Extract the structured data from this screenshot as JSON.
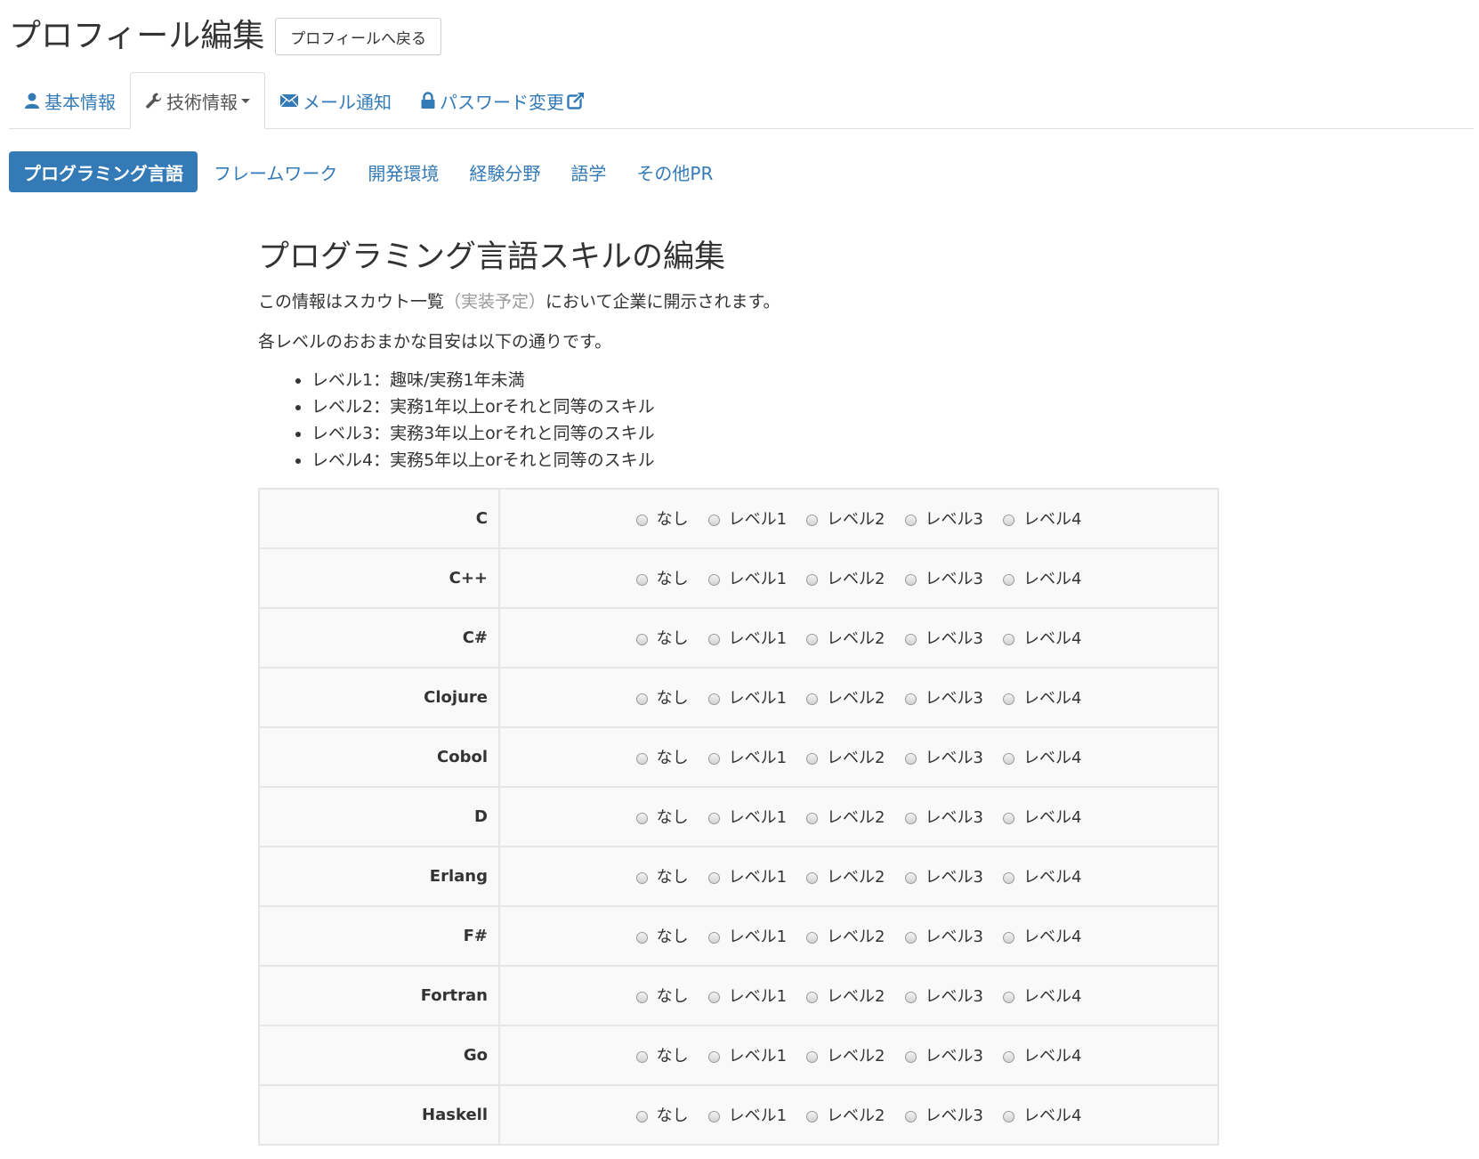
{
  "header": {
    "title": "プロフィール編集",
    "back_label": "プロフィールへ戻る"
  },
  "tabs": [
    {
      "label": "基本情報",
      "icon": "user-icon"
    },
    {
      "label": "技術情報",
      "icon": "wrench-icon",
      "active": true
    },
    {
      "label": "メール通知",
      "icon": "envelope-icon"
    },
    {
      "label": "パスワード変更",
      "icon": "lock-icon",
      "trailing_icon": "external-link-icon"
    }
  ],
  "pills": [
    {
      "label": "プログラミング言語",
      "active": true
    },
    {
      "label": "フレームワーク"
    },
    {
      "label": "開発環境"
    },
    {
      "label": "経験分野"
    },
    {
      "label": "語学"
    },
    {
      "label": "その他PR"
    }
  ],
  "section": {
    "title": "プログラミング言語スキルの編集",
    "desc_part1": "この情報はスカウト一覧",
    "desc_muted": "（実装予定）",
    "desc_part2": "において企業に開示されます。",
    "levels_intro": "各レベルのおおまかな目安は以下の通りです。",
    "levels": [
      "レベル1：趣味/実務1年未満",
      "レベル2：実務1年以上orそれと同等のスキル",
      "レベル3：実務3年以上orそれと同等のスキル",
      "レベル4：実務5年以上orそれと同等のスキル"
    ]
  },
  "skill_options": [
    "なし",
    "レベル1",
    "レベル2",
    "レベル3",
    "レベル4"
  ],
  "languages": [
    "C",
    "C++",
    "C#",
    "Clojure",
    "Cobol",
    "D",
    "Erlang",
    "F#",
    "Fortran",
    "Go",
    "Haskell"
  ],
  "colors": {
    "primary": "#337ab7",
    "muted": "#999999",
    "border": "#dddddd",
    "table_bg": "#f9f9f9"
  }
}
